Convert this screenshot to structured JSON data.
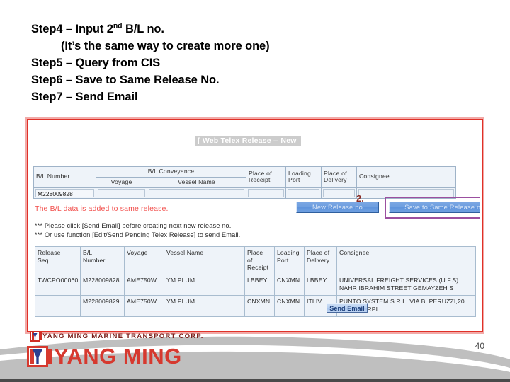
{
  "slide": {
    "page_number": "40",
    "steps": [
      {
        "prefix": "Step4 – Input 2",
        "sup": "nd",
        "suffix": " B/L no.",
        "indent": false
      },
      {
        "prefix": "(It’s the same way to create more one)",
        "sup": "",
        "suffix": "",
        "indent": true
      },
      {
        "prefix": "Step5 – Query from CIS",
        "sup": "",
        "suffix": "",
        "indent": false
      },
      {
        "prefix": "Step6 – Save to Same Release No.",
        "sup": "",
        "suffix": "",
        "indent": false
      },
      {
        "prefix": "Step7 – Send Email",
        "sup": "",
        "suffix": "",
        "indent": false
      }
    ]
  },
  "screenshot": {
    "page_title": "[ Web Telex Release -- New",
    "entry_table": {
      "headers": {
        "bl_number": "B/L Number",
        "conveyance": "B/L Conveyance",
        "voyage": "Voyage",
        "vessel_name": "Vessel Name",
        "place_of_receipt": "Place of\nReceipt",
        "loading_port": "Loading\nPort",
        "place_of_delivery": "Place of\nDelivery",
        "consignee": "Consignee"
      },
      "row": {
        "bl_number": "M228009828",
        "voyage": "",
        "vessel_name": "",
        "place_of_receipt": "",
        "loading_port": "",
        "place_of_delivery": "",
        "consignee": ""
      }
    },
    "status_message": "The B/L data is added to same release.",
    "buttons": {
      "new_release": "New Release no",
      "save_same_release": "Save to Same Release no",
      "send_email": "Send Email"
    },
    "annotation": "2.",
    "notes": [
      "*** Please click [Send Email] before creating next new release no.",
      "*** Or use function [Edit/Send Pending Telex Release] to send Email."
    ],
    "result_table": {
      "headers": [
        "Release\nSeq.",
        "B/L\nNumber",
        "Voyage",
        "Vessel Name",
        "Place\nof\nReceipt",
        "Loading\nPort",
        "Place of\nDelivery",
        "Consignee"
      ],
      "rows": [
        {
          "release_seq": "TWCPO00060",
          "bl_number": "M228009828",
          "voyage": "AME750W",
          "vessel_name": "YM PLUM",
          "place_of_receipt": "LBBEY",
          "loading_port": "CNXMN",
          "place_of_delivery": "LBBEY",
          "consignee": "UNIVERSAL FREIGHT SERVICES (U.F.S) NAHR IBRAHIM STREET GEMAYZEH S"
        },
        {
          "release_seq": "",
          "bl_number": "M228009829",
          "voyage": "AME750W",
          "vessel_name": "YM PLUM",
          "place_of_receipt": "CNXMN",
          "loading_port": "CNXMN",
          "place_of_delivery": "ITLIV",
          "consignee": "PUNTO SYSTEM S.R.L. VIA B. PERUZZI,20 41012 CARPI"
        }
      ]
    }
  },
  "footer": {
    "corp_line": "YANG MING MARINE TRANSPORT CORP.",
    "logo_text": "YANG MING"
  },
  "colors": {
    "brand_red": "#d6392f",
    "brand_blue": "#2d3f8f",
    "frame_red": "#e03127",
    "highlight_purple": "#9b4fa0",
    "status_red": "#f2514e",
    "button_blue": "#6f9fe0"
  }
}
